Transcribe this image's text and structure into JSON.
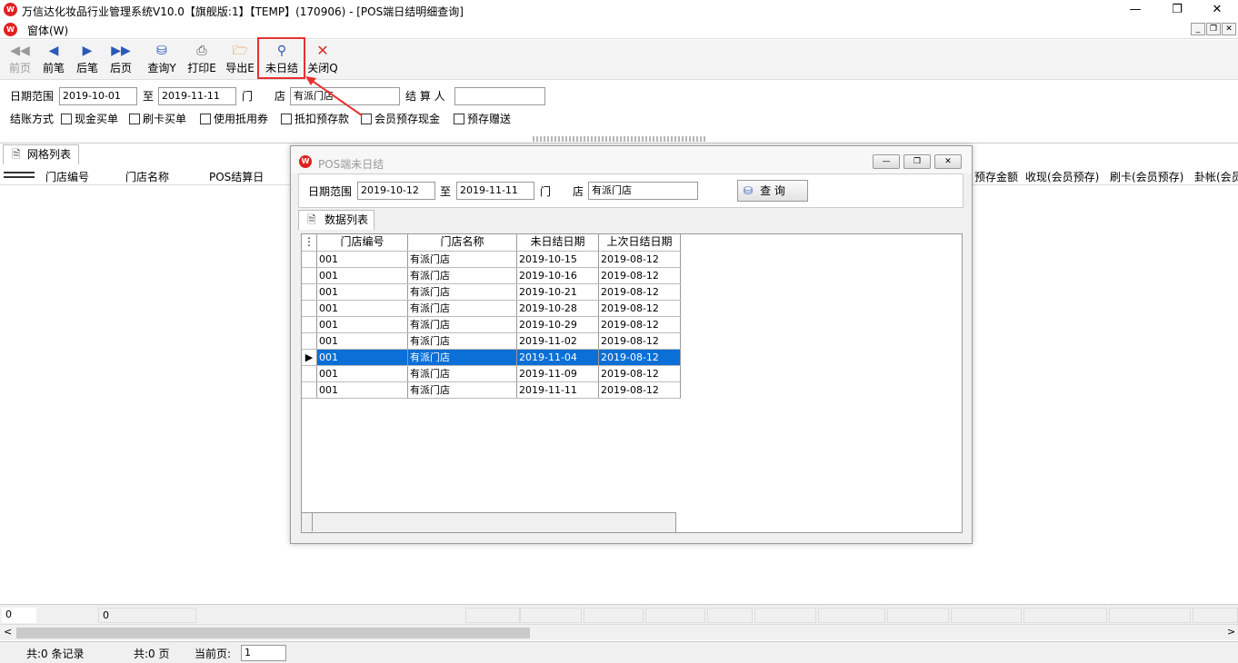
{
  "window": {
    "title": "万信达化妆品行业管理系统V10.0【旗舰版:1】【TEMP】(170906) - [POS端日结明细查询]",
    "logo": "logo-icon"
  },
  "menu": {
    "item": "窗体(W)"
  },
  "toolbar": {
    "items": [
      {
        "label": "前页",
        "icon": "double-left-arrow-icon",
        "enabled": false
      },
      {
        "label": "前笔",
        "icon": "left-arrow-icon",
        "enabled": true
      },
      {
        "label": "后笔",
        "icon": "right-arrow-icon",
        "enabled": true
      },
      {
        "label": "后页",
        "icon": "double-right-arrow-icon",
        "enabled": true
      },
      {
        "label": "查询Y",
        "icon": "query-icon",
        "enabled": true
      },
      {
        "label": "打印E",
        "icon": "printer-icon",
        "enabled": true
      },
      {
        "label": "导出E",
        "icon": "export-icon",
        "enabled": true
      },
      {
        "label": "未日结",
        "icon": "magnifier-icon",
        "enabled": true
      },
      {
        "label": "关闭Q",
        "icon": "close-icon",
        "enabled": true
      }
    ]
  },
  "filter": {
    "date_range_label": "日期范围",
    "date_from": "2019-10-01",
    "to_label": "至",
    "date_to": "2019-11-11",
    "store_label_1": "门",
    "store_label_2": "店",
    "store_value": "有派门店",
    "settler_label": "结 算 人",
    "settler_value": "",
    "settle_method_label": "结账方式",
    "methods": [
      "现金买单",
      "刷卡买单",
      "使用抵用券",
      "抵扣预存款",
      "会员预存现金",
      "预存赠送"
    ]
  },
  "main": {
    "tab_label": "网格列表",
    "columns_left": [
      "门店编号",
      "门店名称",
      "POS结算日"
    ],
    "columns_right": [
      "预存金额",
      "收现(会员预存)",
      "刷卡(会员预存)",
      "卦帐(会员"
    ]
  },
  "footer": {
    "cell1": "0",
    "cell2": "0"
  },
  "status": {
    "records": "共:0 条记录",
    "pages": "共:0 页",
    "current_label": "当前页:",
    "current_value": "1"
  },
  "dialog": {
    "title": "POS端未日结",
    "date_range_label": "日期范围",
    "date_from": "2019-10-12",
    "to_label": "至",
    "date_to": "2019-11-11",
    "store_label_1": "门",
    "store_label_2": "店",
    "store_value": "有派门店",
    "query_button": "查  询",
    "tab_label": "数据列表",
    "columns": [
      "门店编号",
      "门店名称",
      "未日结日期",
      "上次日结日期"
    ],
    "rows": [
      [
        "001",
        "有派门店",
        "2019-10-15",
        "2019-08-12"
      ],
      [
        "001",
        "有派门店",
        "2019-10-16",
        "2019-08-12"
      ],
      [
        "001",
        "有派门店",
        "2019-10-21",
        "2019-08-12"
      ],
      [
        "001",
        "有派门店",
        "2019-10-28",
        "2019-08-12"
      ],
      [
        "001",
        "有派门店",
        "2019-10-29",
        "2019-08-12"
      ],
      [
        "001",
        "有派门店",
        "2019-11-02",
        "2019-08-12"
      ],
      [
        "001",
        "有派门店",
        "2019-11-04",
        "2019-08-12"
      ],
      [
        "001",
        "有派门店",
        "2019-11-09",
        "2019-08-12"
      ],
      [
        "001",
        "有派门店",
        "2019-11-11",
        "2019-08-12"
      ]
    ],
    "selected_row": 6
  },
  "colors": {
    "selection": "#0a6fd6",
    "highlight_box": "#e83030"
  }
}
